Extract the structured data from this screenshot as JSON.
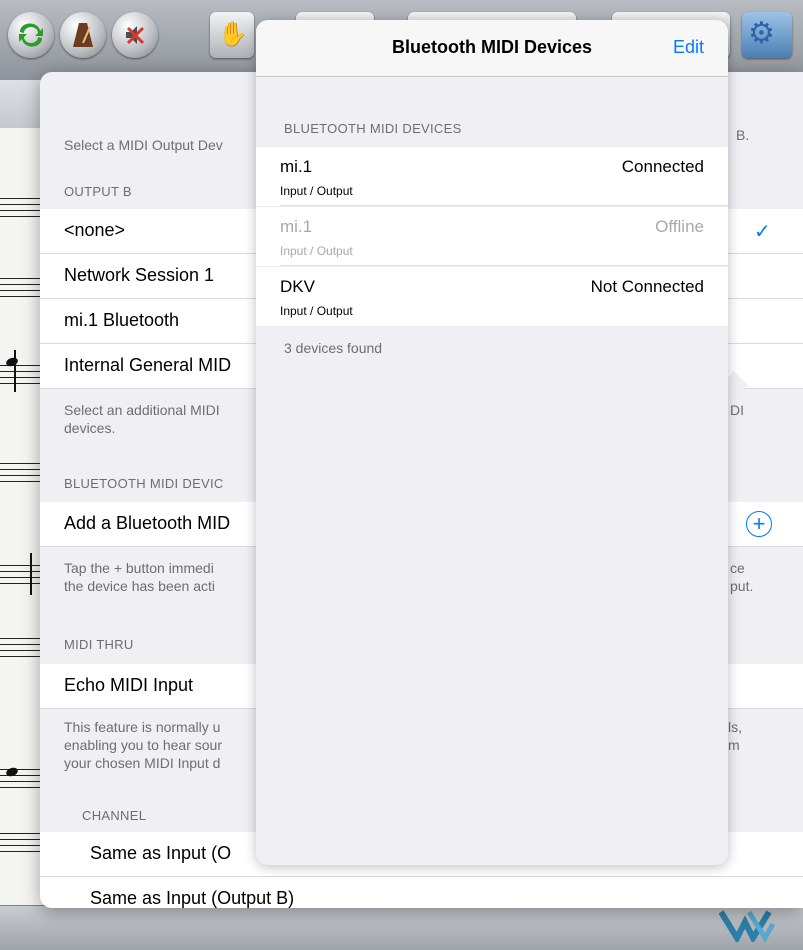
{
  "settings": {
    "output_b_footer_fragment": "Select a MIDI Output Dev",
    "output_b_footer_right": "B.",
    "output_b_header": "OUTPUT B",
    "output_items": [
      {
        "label": "<none>"
      },
      {
        "label": "Network Session 1"
      },
      {
        "label": "mi.1 Bluetooth"
      },
      {
        "label": "Internal General MID"
      }
    ],
    "additional_footer_line1": "Select an additional MIDI",
    "additional_footer_line2": "devices.",
    "additional_footer_right": "DI",
    "bt_header": "BLUETOOTH MIDI DEVIC",
    "add_bt_label": "Add a Bluetooth MID",
    "tap_footer_line1": "Tap the + button immedi",
    "tap_footer_line2": "the device has been acti",
    "tap_footer_right1": "ce",
    "tap_footer_right2": "put.",
    "midi_thru_header": "MIDI THRU",
    "echo_label": "Echo MIDI Input",
    "feature_footer_line1": "This feature is normally u",
    "feature_footer_line2": "enabling you to hear sour",
    "feature_footer_line3": "your chosen MIDI Input d",
    "feature_footer_right1": "ls,",
    "feature_footer_right2": "m",
    "channel_header": "CHANNEL",
    "channel_items": [
      {
        "label": "Same as Input (O"
      },
      {
        "label": "Same as Input (Output B)"
      }
    ]
  },
  "bt_popover": {
    "title": "Bluetooth MIDI Devices",
    "edit_label": "Edit",
    "section_header": "BLUETOOTH MIDI DEVICES",
    "devices": [
      {
        "name": "mi.1",
        "io": "Input / Output",
        "status": "Connected"
      },
      {
        "name": "mi.1",
        "io": "Input / Output",
        "status": "Offline"
      },
      {
        "name": "DKV",
        "io": "Input / Output",
        "status": "Not Connected"
      }
    ],
    "found_text": "3 devices found"
  },
  "icons": {
    "checkmark": "✓",
    "plus": "+",
    "accent_color": "#007aff"
  }
}
